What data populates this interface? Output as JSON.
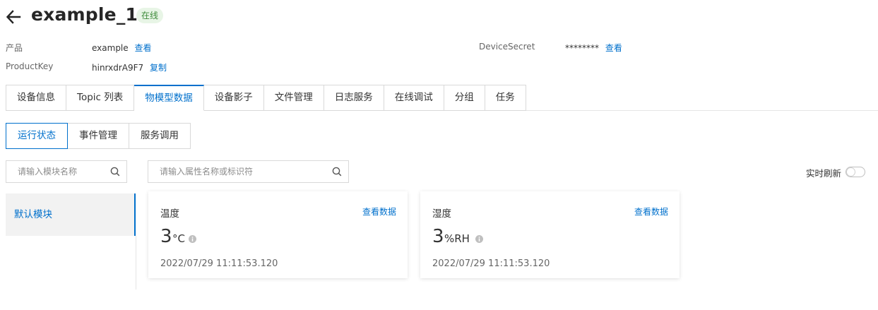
{
  "header": {
    "title": "example_1",
    "status": "在线"
  },
  "info": {
    "product_label": "产品",
    "product_value": "example",
    "product_link": "查看",
    "productkey_label": "ProductKey",
    "productkey_value": "hinrxdrA9F7",
    "productkey_link": "复制",
    "secret_label": "DeviceSecret",
    "secret_value": "********",
    "secret_link": "查看"
  },
  "tabs": [
    "设备信息",
    "Topic 列表",
    "物模型数据",
    "设备影子",
    "文件管理",
    "日志服务",
    "在线调试",
    "分组",
    "任务"
  ],
  "active_tab": 2,
  "subtabs": [
    "运行状态",
    "事件管理",
    "服务调用"
  ],
  "active_subtab": 0,
  "module_search": {
    "placeholder": "请输入模块名称"
  },
  "property_search": {
    "placeholder": "请输入属性名称或标识符"
  },
  "modules": [
    "默认模块"
  ],
  "realtime": {
    "label": "实时刷新",
    "enabled": false
  },
  "cards": [
    {
      "name": "温度",
      "link": "查看数据",
      "value": "3",
      "unit": "°C",
      "time": "2022/07/29 11:11:53.120"
    },
    {
      "name": "湿度",
      "link": "查看数据",
      "value": "3",
      "unit": "%RH",
      "time": "2022/07/29 11:11:53.120"
    }
  ],
  "colors": {
    "accent": "#0070cc",
    "status_bg": "#e8f5e6",
    "status_text": "#3d8a3a"
  }
}
